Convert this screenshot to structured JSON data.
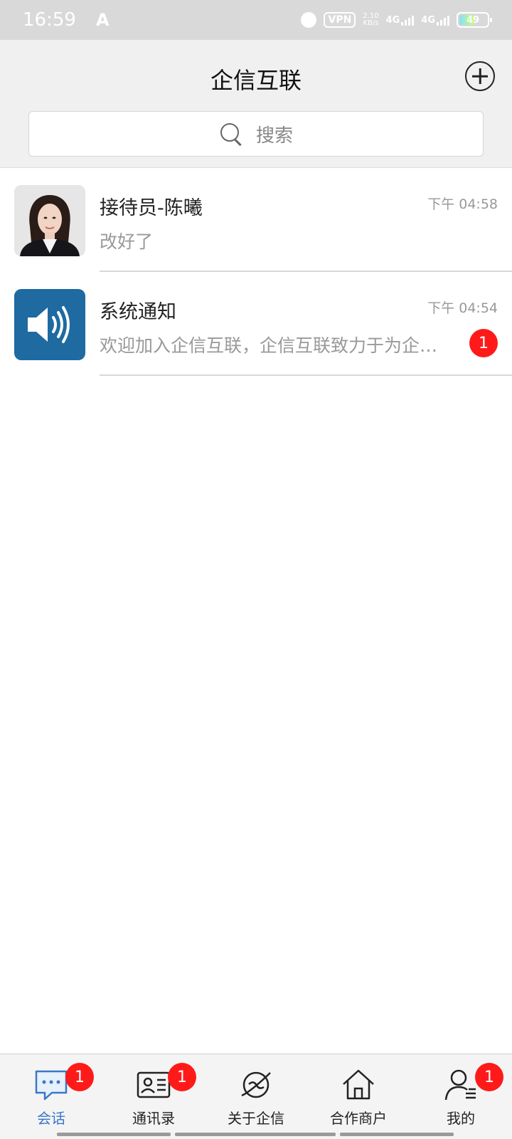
{
  "status_bar": {
    "time": "16:59",
    "a_icon": "A",
    "vpn": "VPN",
    "speed_value": "2.10",
    "speed_unit": "KB/s",
    "net1": "4G",
    "net2": "4G",
    "battery": "49"
  },
  "header": {
    "title": "企信互联",
    "search_placeholder": "搜索"
  },
  "conversations": [
    {
      "name": "接待员-陈曦",
      "time": "下午 04:58",
      "preview": "改好了",
      "avatar": "person-photo-icon"
    },
    {
      "name": "系统通知",
      "time": "下午 04:54",
      "preview": "欢迎加入企信互联，企信互联致力于为企业打造全新",
      "badge": "1",
      "avatar": "speaker-icon"
    }
  ],
  "nav": {
    "items": [
      {
        "label": "会话",
        "badge": "1",
        "icon": "chat-bubble-icon",
        "active": true
      },
      {
        "label": "通讯录",
        "badge": "1",
        "icon": "contact-card-icon"
      },
      {
        "label": "关于企信",
        "icon": "planet-icon"
      },
      {
        "label": "合作商户",
        "icon": "home-icon"
      },
      {
        "label": "我的",
        "badge": "1",
        "icon": "profile-icon"
      }
    ]
  },
  "colors": {
    "accent": "#3a78c8",
    "badge": "#ff1a1a",
    "system_avatar": "#1e6aa1"
  }
}
